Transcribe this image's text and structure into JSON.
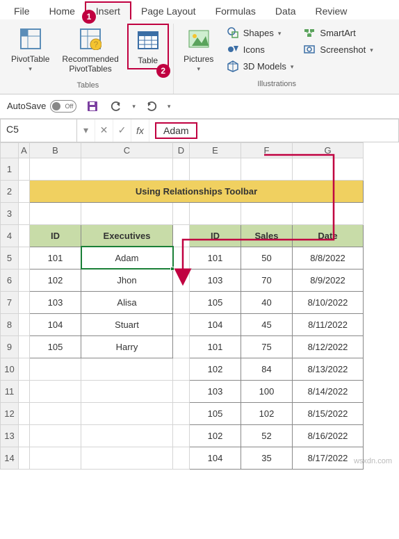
{
  "tabs": [
    "File",
    "Home",
    "Insert",
    "Page Layout",
    "Formulas",
    "Data",
    "Review"
  ],
  "active_tab_index": 2,
  "ribbon": {
    "tables_group": {
      "label": "Tables",
      "pivottable": "PivotTable",
      "recommended": "Recommended\nPivotTables",
      "table": "Table"
    },
    "illustrations_group": {
      "label": "Illustrations",
      "pictures": "Pictures",
      "shapes": "Shapes",
      "icons": "Icons",
      "models3d": "3D Models",
      "smartart": "SmartArt",
      "screenshot": "Screenshot"
    }
  },
  "qat": {
    "autosave": "AutoSave",
    "autosave_state": "Off"
  },
  "namebox": "C5",
  "formula_bar_value": "Adam",
  "cols": [
    "A",
    "B",
    "C",
    "D",
    "E",
    "F",
    "G"
  ],
  "rows": [
    "1",
    "2",
    "3",
    "4",
    "5",
    "6",
    "7",
    "8",
    "9",
    "10",
    "11",
    "12",
    "13",
    "14"
  ],
  "sheet": {
    "title": "Using Relationships Toolbar",
    "left": {
      "headers": [
        "ID",
        "Executives"
      ],
      "rows": [
        [
          "101",
          "Adam"
        ],
        [
          "102",
          "Jhon"
        ],
        [
          "103",
          "Alisa"
        ],
        [
          "104",
          "Stuart"
        ],
        [
          "105",
          "Harry"
        ]
      ]
    },
    "right": {
      "headers": [
        "ID",
        "Sales",
        "Date"
      ],
      "rows": [
        [
          "101",
          "50",
          "8/8/2022"
        ],
        [
          "103",
          "70",
          "8/9/2022"
        ],
        [
          "105",
          "40",
          "8/10/2022"
        ],
        [
          "104",
          "45",
          "8/11/2022"
        ],
        [
          "101",
          "75",
          "8/12/2022"
        ],
        [
          "102",
          "84",
          "8/13/2022"
        ],
        [
          "103",
          "100",
          "8/14/2022"
        ],
        [
          "105",
          "102",
          "8/15/2022"
        ],
        [
          "102",
          "52",
          "8/16/2022"
        ],
        [
          "104",
          "35",
          "8/17/2022"
        ]
      ]
    }
  },
  "callouts": {
    "one": "1",
    "two": "2"
  },
  "watermark": "wsxdn.com"
}
